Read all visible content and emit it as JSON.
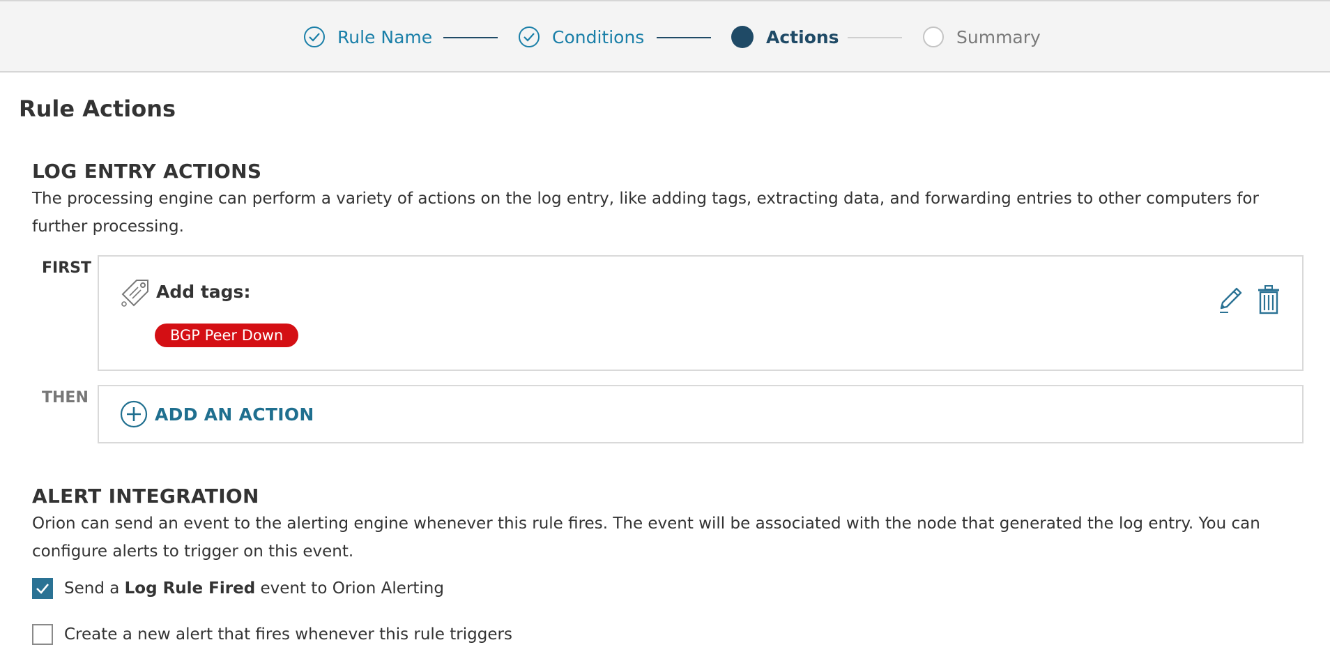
{
  "wizard": {
    "steps": [
      {
        "label": "Rule Name",
        "state": "complete"
      },
      {
        "label": "Conditions",
        "state": "complete"
      },
      {
        "label": "Actions",
        "state": "current"
      },
      {
        "label": "Summary",
        "state": "pending"
      }
    ]
  },
  "page": {
    "title": "Rule Actions"
  },
  "log_entry_actions": {
    "heading": "LOG ENTRY ACTIONS",
    "description": "The processing engine can perform a variety of actions on the log entry, like adding tags, extracting data, and forwarding entries to other computers for further processing.",
    "first_label": "FIRST",
    "then_label": "THEN",
    "action": {
      "title": "Add tags:",
      "icon": "tag-icon",
      "tags": [
        "BGP Peer Down"
      ],
      "edit_icon": "pencil-icon",
      "delete_icon": "trash-icon"
    },
    "add_action_label": "ADD AN ACTION"
  },
  "alert_integration": {
    "heading": "ALERT INTEGRATION",
    "description": "Orion can send an event to the alerting engine whenever this rule fires. The event will be associated with the node that generated the log entry. You can configure alerts to trigger on this event.",
    "options": [
      {
        "prefix": "Send a ",
        "bold": "Log Rule Fired",
        "suffix": " event to Orion Alerting",
        "checked": true
      },
      {
        "prefix": "Create a new alert that fires whenever this rule triggers",
        "bold": "",
        "suffix": "",
        "checked": false
      }
    ]
  },
  "colors": {
    "accent": "#1a7fa8",
    "active_step": "#1f4a66",
    "tag_red": "#d40f14",
    "checkbox": "#2a7294"
  }
}
